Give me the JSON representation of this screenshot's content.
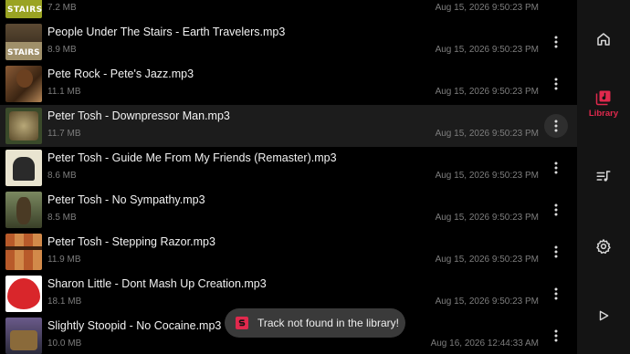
{
  "tracks": [
    {
      "title": "",
      "size": "7.2 MB",
      "date": "Aug 15, 2026 9:50:23 PM",
      "art_text": "STAIRS"
    },
    {
      "title": "People Under The Stairs - Earth Travelers.mp3",
      "size": "8.9 MB",
      "date": "Aug 15, 2026 9:50:23 PM",
      "art_text": "STAIRS"
    },
    {
      "title": "Pete Rock - Pete's Jazz.mp3",
      "size": "11.1 MB",
      "date": "Aug 15, 2026 9:50:23 PM"
    },
    {
      "title": "Peter Tosh - Downpressor Man.mp3",
      "size": "11.7 MB",
      "date": "Aug 15, 2026 9:50:23 PM",
      "selected": true
    },
    {
      "title": "Peter Tosh - Guide Me From My Friends (Remaster).mp3",
      "size": "8.6 MB",
      "date": "Aug 15, 2026 9:50:23 PM"
    },
    {
      "title": "Peter Tosh - No Sympathy.mp3",
      "size": "8.5 MB",
      "date": "Aug 15, 2026 9:50:23 PM"
    },
    {
      "title": "Peter Tosh - Stepping Razor.mp3",
      "size": "11.9 MB",
      "date": "Aug 15, 2026 9:50:23 PM"
    },
    {
      "title": "Sharon Little - Dont Mash Up Creation.mp3",
      "size": "18.1 MB",
      "date": "Aug 15, 2026 9:50:23 PM"
    },
    {
      "title": "Slightly Stoopid - No Cocaine.mp3",
      "size": "10.0 MB",
      "date": "Aug 16, 2026 12:44:33 AM"
    }
  ],
  "nav": {
    "items": [
      {
        "id": "home",
        "icon": "home-icon",
        "label": ""
      },
      {
        "id": "library",
        "icon": "library-icon",
        "label": "Library",
        "active": true
      },
      {
        "id": "queue",
        "icon": "queue-music-icon",
        "label": ""
      },
      {
        "id": "settings",
        "icon": "gear-icon",
        "label": ""
      },
      {
        "id": "play",
        "icon": "play-icon",
        "label": ""
      }
    ],
    "accent_color": "#e0294d"
  },
  "toast": {
    "message": "Track not found in the library!",
    "icon": "app-logo-icon"
  }
}
